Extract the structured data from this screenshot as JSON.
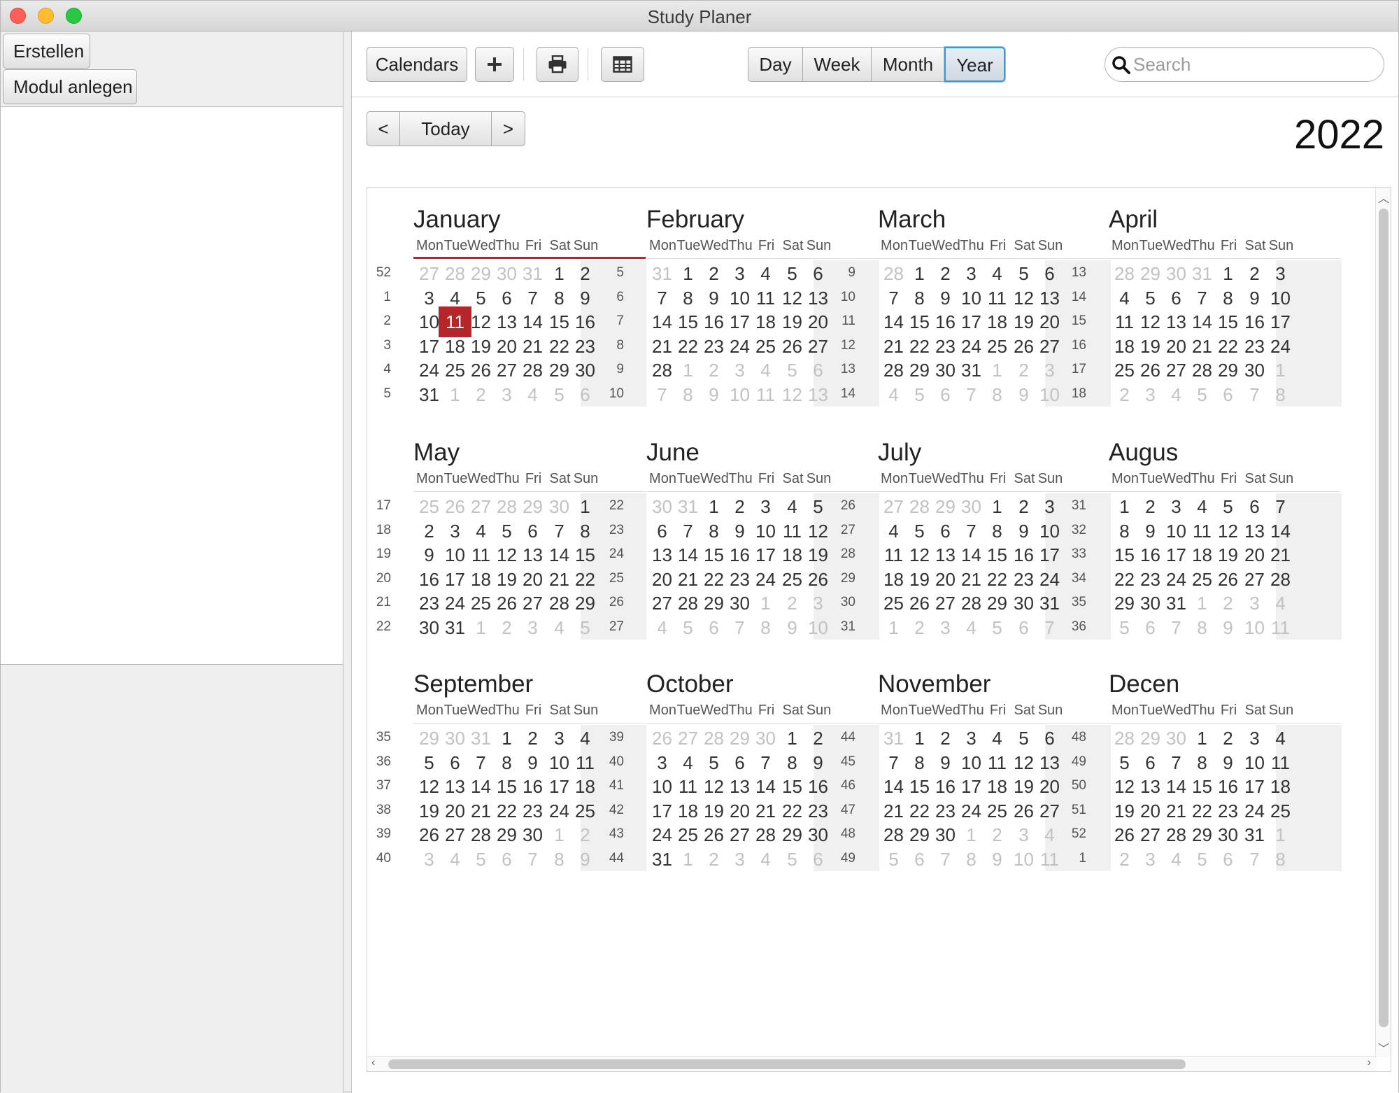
{
  "window": {
    "title": "Study Planer"
  },
  "left": {
    "buttons": [
      "Erstellen",
      "Modul anlegen"
    ]
  },
  "toolbar": {
    "calendars_label": "Calendars",
    "views": [
      "Day",
      "Week",
      "Month",
      "Year"
    ],
    "selected_view": "Year",
    "search_placeholder": "Search",
    "icons": {
      "add": "plus-icon",
      "print": "printer-icon",
      "table": "table-icon",
      "search": "search-icon"
    }
  },
  "nav": {
    "prev": "<",
    "today": "Today",
    "next": ">"
  },
  "year": "2022",
  "today": {
    "month": 0,
    "day": 11
  },
  "weekday_headers": [
    "Mon",
    "Tue",
    "Wed",
    "Thu",
    "Fri",
    "Sat",
    "Sun"
  ],
  "months": [
    {
      "name": "January",
      "weeks": [
        52,
        1,
        2,
        3,
        4,
        5
      ]
    },
    {
      "name": "February",
      "weeks": [
        5,
        6,
        7,
        8,
        9,
        10
      ]
    },
    {
      "name": "March",
      "weeks": [
        9,
        10,
        11,
        12,
        13,
        14
      ]
    },
    {
      "name": "April",
      "weeks": [
        13,
        14,
        15,
        16,
        17,
        18
      ]
    },
    {
      "name": "May",
      "weeks": [
        17,
        18,
        19,
        20,
        21,
        22
      ]
    },
    {
      "name": "June",
      "weeks": [
        22,
        23,
        24,
        25,
        26,
        27
      ]
    },
    {
      "name": "July",
      "weeks": [
        26,
        27,
        28,
        29,
        30,
        31
      ]
    },
    {
      "name": "Augus",
      "weeks": [
        31,
        32,
        33,
        34,
        35,
        36
      ]
    },
    {
      "name": "September",
      "weeks": [
        35,
        36,
        37,
        38,
        39,
        40
      ]
    },
    {
      "name": "October",
      "weeks": [
        39,
        40,
        41,
        42,
        43,
        44
      ]
    },
    {
      "name": "November",
      "weeks": [
        44,
        45,
        46,
        47,
        48,
        49
      ]
    },
    {
      "name": "Decen",
      "weeks": [
        48,
        49,
        50,
        51,
        52,
        1
      ]
    }
  ],
  "colors": {
    "accent": "#b5262b",
    "selection": "#3a9ad9"
  }
}
